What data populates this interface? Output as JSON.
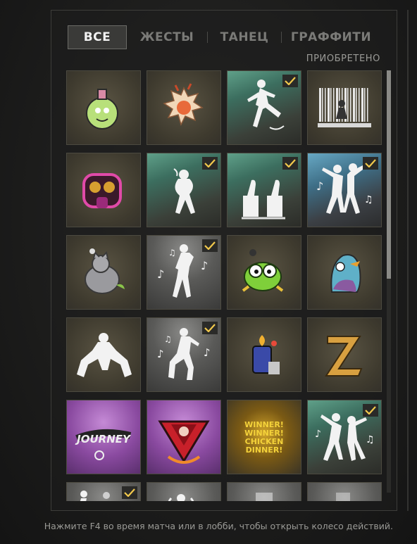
{
  "tabs": [
    {
      "label": "ВСЕ",
      "active": true
    },
    {
      "label": "ЖЕСТЫ",
      "active": false
    },
    {
      "label": "ТАНЕЦ",
      "active": false
    },
    {
      "label": "ГРАФФИТИ",
      "active": false
    }
  ],
  "acquired_label": "ПРИОБРЕТЕНО",
  "hint_text": "Нажмите F4 во время матча или в лобби, чтобы открыть колесо действий.",
  "items": [
    {
      "name": "potion-frog-graffiti-icon",
      "style": "tan",
      "checked": false
    },
    {
      "name": "flame-creature-graffiti-icon",
      "style": "tan",
      "checked": false
    },
    {
      "name": "kick-emote-icon",
      "style": "green",
      "checked": true
    },
    {
      "name": "barcode-graffiti-icon",
      "style": "tan",
      "checked": false
    },
    {
      "name": "gas-mask-graffiti-icon",
      "style": "tan",
      "checked": false
    },
    {
      "name": "laughing-emote-icon",
      "style": "green",
      "checked": true
    },
    {
      "name": "thumbs-up-emote-icon",
      "style": "green",
      "checked": true
    },
    {
      "name": "duo-dance-icon",
      "style": "blue",
      "checked": true
    },
    {
      "name": "chicken-cat-graffiti-icon",
      "style": "tan",
      "checked": false
    },
    {
      "name": "solo-dance-icon",
      "style": "gray",
      "checked": true
    },
    {
      "name": "grenade-frog-graffiti-icon",
      "style": "tan",
      "checked": false
    },
    {
      "name": "cuckoo-bird-graffiti-icon",
      "style": "tan",
      "checked": false
    },
    {
      "name": "squat-emote-icon",
      "style": "tan",
      "checked": false
    },
    {
      "name": "groove-dance-icon",
      "style": "gray",
      "checked": true
    },
    {
      "name": "lighter-graffiti-icon",
      "style": "tan",
      "checked": false
    },
    {
      "name": "z-letter-graffiti-icon",
      "style": "tan",
      "checked": false
    },
    {
      "name": "journey-graffiti-icon",
      "style": "purple",
      "checked": false,
      "text": "JOURNEY"
    },
    {
      "name": "wolf-badge-graffiti-icon",
      "style": "purple",
      "checked": false
    },
    {
      "name": "winner-chicken-dinner-icon",
      "style": "gold",
      "checked": false,
      "text": "WINNER! WINNER! CHICKEN DINNER!"
    },
    {
      "name": "party-dance-icon",
      "style": "green",
      "checked": true
    },
    {
      "name": "partial-emote-icon-1",
      "style": "gray",
      "checked": true
    },
    {
      "name": "partial-emote-icon-2",
      "style": "gray",
      "checked": false
    },
    {
      "name": "partial-emote-icon-3",
      "style": "gray",
      "checked": false
    },
    {
      "name": "partial-emote-icon-4",
      "style": "gray",
      "checked": false
    }
  ],
  "colors": {
    "check": "#f2c94c",
    "accent_text": "#f2f2f2"
  }
}
